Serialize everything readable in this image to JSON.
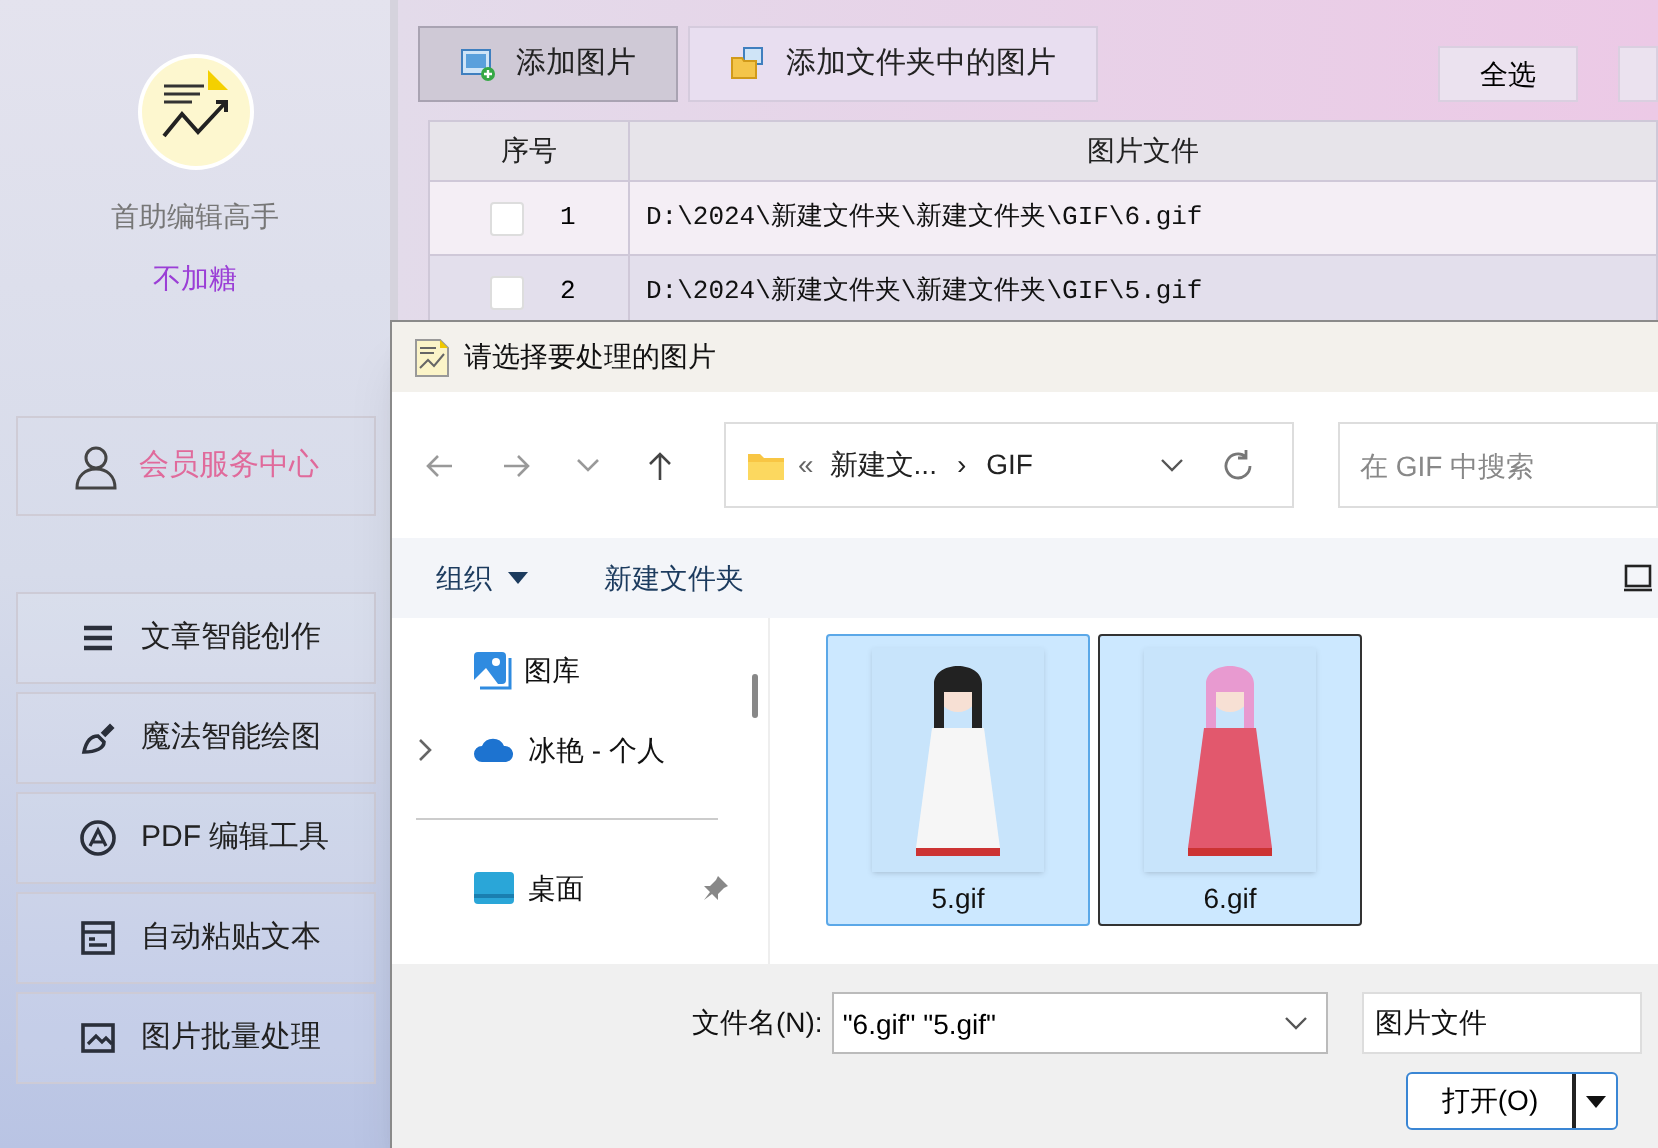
{
  "app": {
    "name": "首助编辑高手",
    "user": "不加糖",
    "member_button": "会员服务中心"
  },
  "nav": [
    {
      "label": "文章智能创作"
    },
    {
      "label": "魔法智能绘图"
    },
    {
      "label": "PDF 编辑工具"
    },
    {
      "label": "自动粘贴文本"
    },
    {
      "label": "图片批量处理"
    }
  ],
  "toolbar": [
    {
      "label": "添加图片",
      "selected": true
    },
    {
      "label": "添加文件夹中的图片",
      "selected": false
    }
  ],
  "select_all": "全选",
  "table": {
    "columns": [
      "序号",
      "图片文件"
    ],
    "rows": [
      {
        "index": "1",
        "checked": false,
        "path": "D:\\2024\\新建文件夹\\新建文件夹\\GIF\\6.gif"
      },
      {
        "index": "2",
        "checked": false,
        "path": "D:\\2024\\新建文件夹\\新建文件夹\\GIF\\5.gif"
      }
    ]
  },
  "dialog": {
    "title": "请选择要处理的图片",
    "breadcrumb": {
      "overflow": "«",
      "items": [
        "新建文...",
        "GIF"
      ],
      "separator": "›"
    },
    "search": {
      "placeholder": "在 GIF 中搜索"
    },
    "commands": [
      {
        "label": "组织",
        "dropdown": true
      },
      {
        "label": "新建文件夹",
        "dropdown": false
      }
    ],
    "nav_pane": [
      {
        "kind": "item",
        "label": "图库",
        "expandable": false,
        "pinned": false
      },
      {
        "kind": "item",
        "label": "冰艳 - 个人",
        "expandable": true,
        "pinned": false
      },
      {
        "kind": "divider"
      },
      {
        "kind": "item",
        "label": "桌面",
        "expandable": false,
        "pinned": true
      }
    ],
    "files": [
      {
        "name": "5.gif",
        "selected": true,
        "focused": false
      },
      {
        "name": "6.gif",
        "selected": true,
        "focused": true
      }
    ],
    "filename_label": "文件名(N):",
    "filename": "\"6.gif\" \"5.gif\"",
    "filetype": "图片文件",
    "open_button": "打开(O)"
  }
}
